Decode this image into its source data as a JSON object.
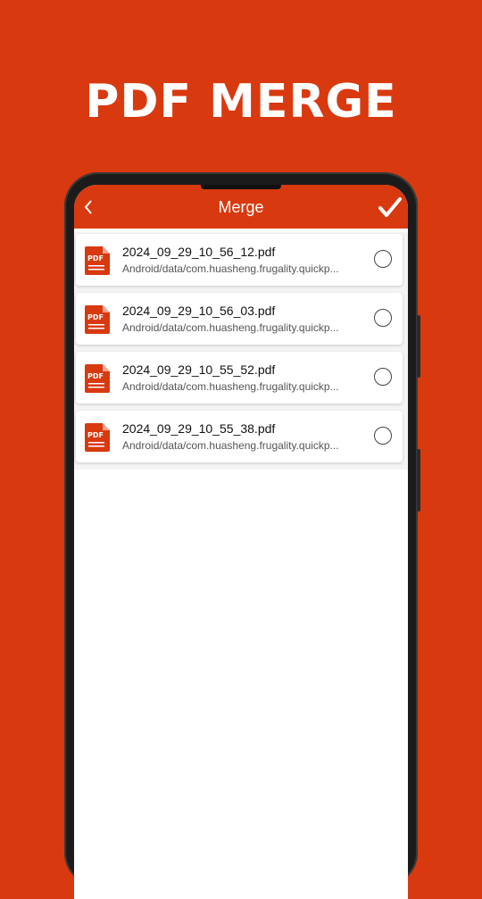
{
  "promo": {
    "title": "PDF MERGE"
  },
  "app_bar": {
    "title": "Merge",
    "back_icon": "chevron-left-icon",
    "confirm_icon": "checkmark-icon"
  },
  "colors": {
    "accent": "#d9390f",
    "pdf_icon": "#d9390f"
  },
  "files": [
    {
      "name": "2024_09_29_10_56_12.pdf",
      "path": "Android/data/com.huasheng.frugality.quickp...",
      "icon_label": "PDF",
      "selected": false
    },
    {
      "name": "2024_09_29_10_56_03.pdf",
      "path": "Android/data/com.huasheng.frugality.quickp...",
      "icon_label": "PDF",
      "selected": false
    },
    {
      "name": "2024_09_29_10_55_52.pdf",
      "path": "Android/data/com.huasheng.frugality.quickp...",
      "icon_label": "PDF",
      "selected": false
    },
    {
      "name": "2024_09_29_10_55_38.pdf",
      "path": "Android/data/com.huasheng.frugality.quickp...",
      "icon_label": "PDF",
      "selected": false
    }
  ]
}
